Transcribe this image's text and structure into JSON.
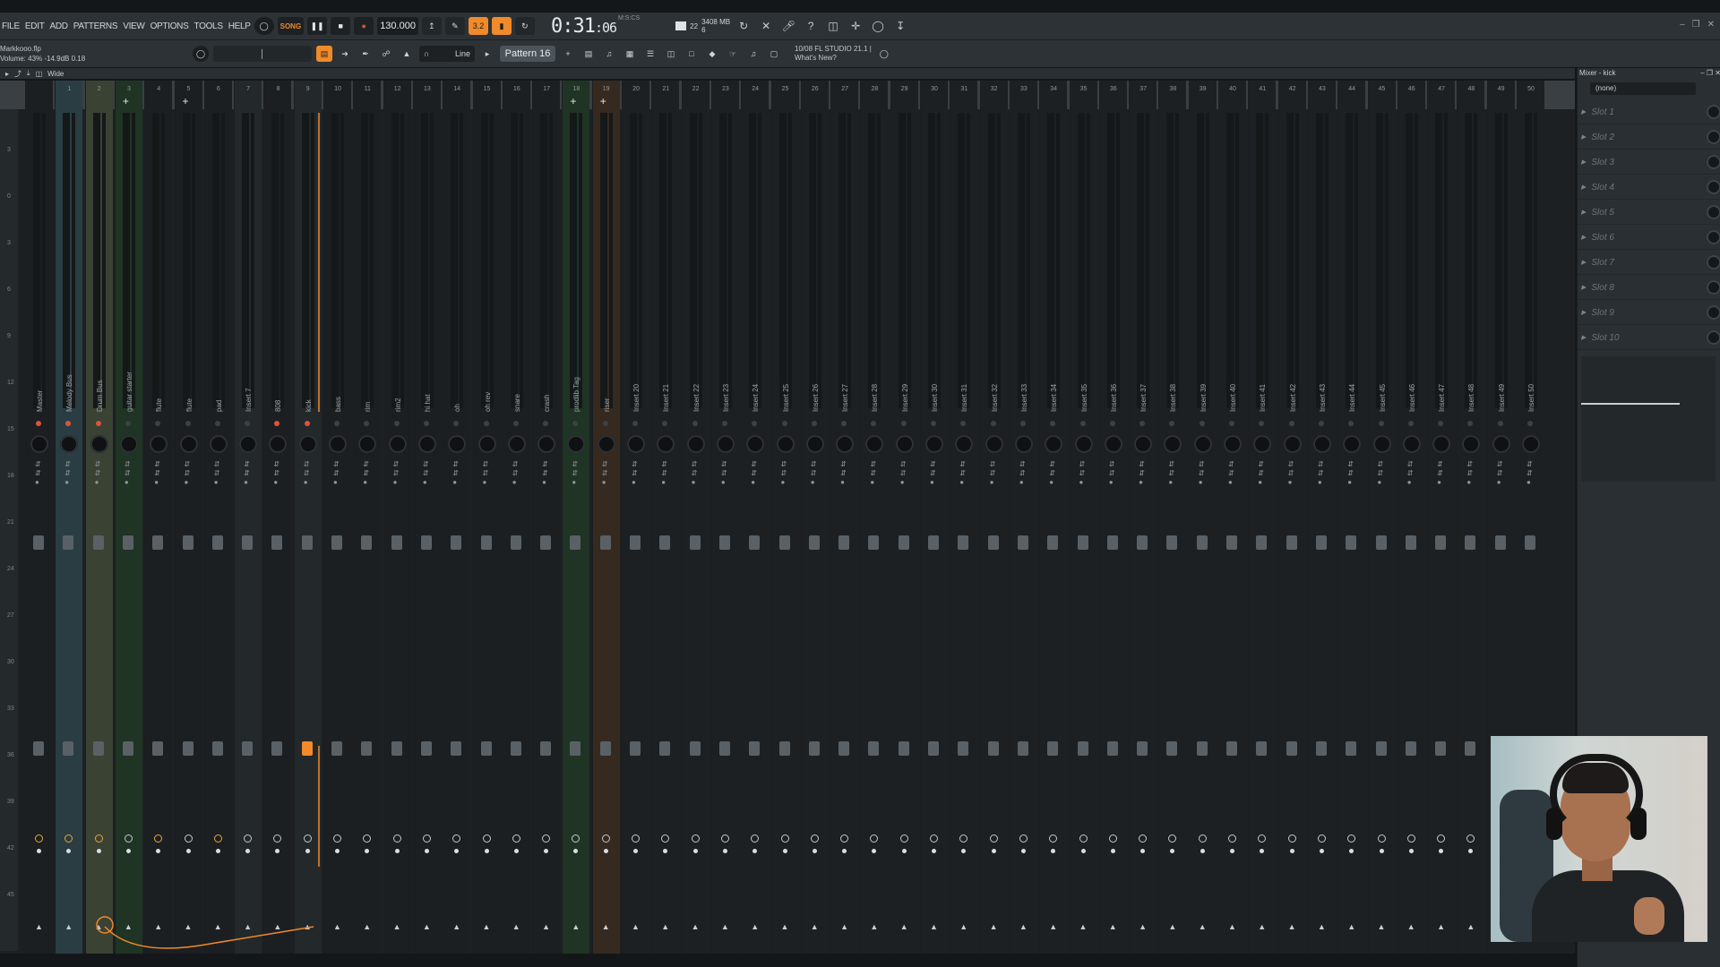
{
  "menu": [
    "FILE",
    "EDIT",
    "ADD",
    "PATTERNS",
    "VIEW",
    "OPTIONS",
    "TOOLS",
    "HELP"
  ],
  "transport": {
    "mode": "SONG",
    "tempo": "130.000",
    "time": "0:31",
    "time_frac": ":06",
    "time_sub": "M:S:CS"
  },
  "cpu": {
    "voices": "22",
    "mem": "3408 MB",
    "poly": "6"
  },
  "file": {
    "name": "Markkooo.flp",
    "status": "Volume: 43%  -14.9dB  0.18"
  },
  "toolbar2": {
    "snap": "Line",
    "pattern": "Pattern 16"
  },
  "news": {
    "date": "10/08",
    "title": "FL STUDIO 21.1 |",
    "subtitle": "What's New?"
  },
  "mixer_header": {
    "view": "Wide"
  },
  "db_scale": [
    "3",
    "0",
    "3",
    "6",
    "9",
    "12",
    "15",
    "18",
    "21",
    "24",
    "27",
    "30",
    "33",
    "36",
    "39",
    "42",
    "45"
  ],
  "strips": [
    {
      "num": "",
      "label": "Master",
      "style": "dark1",
      "red": true,
      "route_orange": true,
      "handle_active": false
    },
    {
      "num": "1",
      "label": "Melody Bus",
      "style": "teal",
      "red": true,
      "route_orange": true,
      "handle_active": false
    },
    {
      "num": "2",
      "label": "Drum Bus",
      "style": "olive",
      "red": true,
      "route_orange": true,
      "handle_active": false
    },
    {
      "num": "3",
      "label": "guitar starter",
      "style": "green",
      "red": false,
      "route_orange": false,
      "handle_active": false
    },
    {
      "num": "4",
      "label": "flute",
      "style": "dark1",
      "red": false,
      "route_orange": true,
      "handle_active": false
    },
    {
      "num": "5",
      "label": "flute",
      "style": "dark1",
      "red": false,
      "route_orange": false,
      "handle_active": false
    },
    {
      "num": "6",
      "label": "pad",
      "style": "dark1",
      "red": false,
      "route_orange": true,
      "handle_active": false
    },
    {
      "num": "7",
      "label": "Insert 7",
      "style": "strip",
      "red": false,
      "route_orange": false,
      "handle_active": false
    },
    {
      "num": "8",
      "label": "808",
      "style": "dark1",
      "red": true,
      "route_orange": false,
      "handle_active": false
    },
    {
      "num": "9",
      "label": "kick",
      "style": "strip",
      "red": true,
      "route_orange": false,
      "handle_active": true
    },
    {
      "num": "10",
      "label": "bass",
      "style": "dark1",
      "red": false,
      "route_orange": false,
      "handle_active": false
    },
    {
      "num": "11",
      "label": "rim",
      "style": "dark1",
      "red": false,
      "route_orange": false,
      "handle_active": false
    },
    {
      "num": "12",
      "label": "rim2",
      "style": "dark1",
      "red": false,
      "route_orange": false,
      "handle_active": false
    },
    {
      "num": "13",
      "label": "hi hat",
      "style": "dark1",
      "red": false,
      "route_orange": false,
      "handle_active": false
    },
    {
      "num": "14",
      "label": "oh",
      "style": "dark1",
      "red": false,
      "route_orange": false,
      "handle_active": false
    },
    {
      "num": "15",
      "label": "oh rev",
      "style": "dark1",
      "red": false,
      "route_orange": false,
      "handle_active": false
    },
    {
      "num": "16",
      "label": "snare",
      "style": "dark1",
      "red": false,
      "route_orange": false,
      "handle_active": false
    },
    {
      "num": "17",
      "label": "crash",
      "style": "dark1",
      "red": false,
      "route_orange": false,
      "handle_active": false
    },
    {
      "num": "18",
      "label": "prodlib Tag",
      "style": "green",
      "red": false,
      "route_orange": false,
      "handle_active": false
    },
    {
      "num": "19",
      "label": "riser",
      "style": "brown",
      "red": false,
      "route_orange": false,
      "handle_active": false
    }
  ],
  "empty_inserts_start": 20,
  "empty_inserts_end": 51,
  "right_panel": {
    "title": "Mixer - kick",
    "preset": "(none)",
    "slots": [
      "Slot 1",
      "Slot 2",
      "Slot 3",
      "Slot 4",
      "Slot 5",
      "Slot 6",
      "Slot 7",
      "Slot 8",
      "Slot 9",
      "Slot 10"
    ]
  },
  "colors": {
    "accent": "#f08a2a",
    "teal": "#2a3d43",
    "green": "#1f3424"
  }
}
